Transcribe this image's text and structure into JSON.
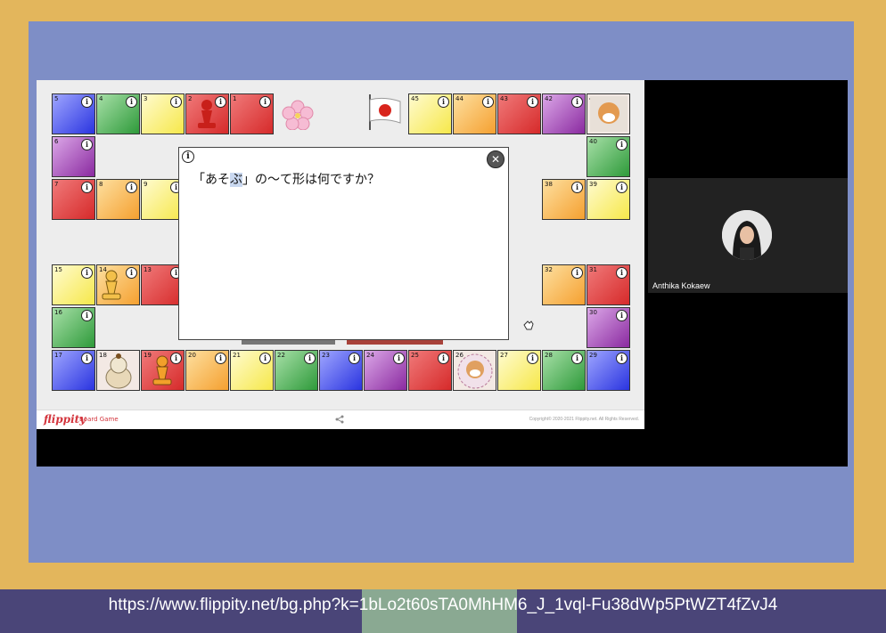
{
  "url": "https://www.flippity.net/bg.php?k=1bLo2t60sTA0MhHM6_J_1vql-Fu38dWp5PtWZT4fZvJ4",
  "board": {
    "cells": [
      {
        "n": "1",
        "color": "red"
      },
      {
        "n": "2",
        "color": "red"
      },
      {
        "n": "3",
        "color": "yellow"
      },
      {
        "n": "4",
        "color": "green"
      },
      {
        "n": "5",
        "color": "blue"
      },
      {
        "n": "6",
        "color": "purple"
      },
      {
        "n": "7",
        "color": "red"
      },
      {
        "n": "8",
        "color": "orange"
      },
      {
        "n": "9",
        "color": "yellow"
      },
      {
        "n": "13",
        "color": "red"
      },
      {
        "n": "14",
        "color": "orange"
      },
      {
        "n": "15",
        "color": "yellow"
      },
      {
        "n": "16",
        "color": "green"
      },
      {
        "n": "17",
        "color": "blue"
      },
      {
        "n": "18",
        "color": "picture"
      },
      {
        "n": "19",
        "color": "red"
      },
      {
        "n": "20",
        "color": "orange"
      },
      {
        "n": "21",
        "color": "yellow"
      },
      {
        "n": "22",
        "color": "green"
      },
      {
        "n": "23",
        "color": "blue"
      },
      {
        "n": "24",
        "color": "purple"
      },
      {
        "n": "25",
        "color": "red"
      },
      {
        "n": "26",
        "color": "picture"
      },
      {
        "n": "27",
        "color": "yellow"
      },
      {
        "n": "28",
        "color": "green"
      },
      {
        "n": "29",
        "color": "blue"
      },
      {
        "n": "30",
        "color": "purple"
      },
      {
        "n": "31",
        "color": "red"
      },
      {
        "n": "32",
        "color": "orange"
      },
      {
        "n": "38",
        "color": "orange"
      },
      {
        "n": "39",
        "color": "yellow"
      },
      {
        "n": "40",
        "color": "green"
      },
      {
        "n": "41",
        "color": "picture"
      },
      {
        "n": "42",
        "color": "purple"
      },
      {
        "n": "43",
        "color": "red"
      },
      {
        "n": "44",
        "color": "orange"
      },
      {
        "n": "45",
        "color": "yellow"
      }
    ],
    "info_glyph": "i"
  },
  "dialog": {
    "info_glyph": "i",
    "question_open": "「あそ",
    "question_highlight": "ぶ",
    "question_close": "」の～て形は何ですか？",
    "close_glyph": "✕"
  },
  "footer": {
    "logo": "flippity",
    "product": "Board Game",
    "copyright": "Copyright© 2020-2021 Flippity.net. All Rights Reserved."
  },
  "participant": {
    "name": "Anthika Kokaew"
  },
  "colors": {
    "frame": "#e3b65c",
    "frame_inner": "#7e8ec6",
    "brand_red": "#d3343c"
  }
}
